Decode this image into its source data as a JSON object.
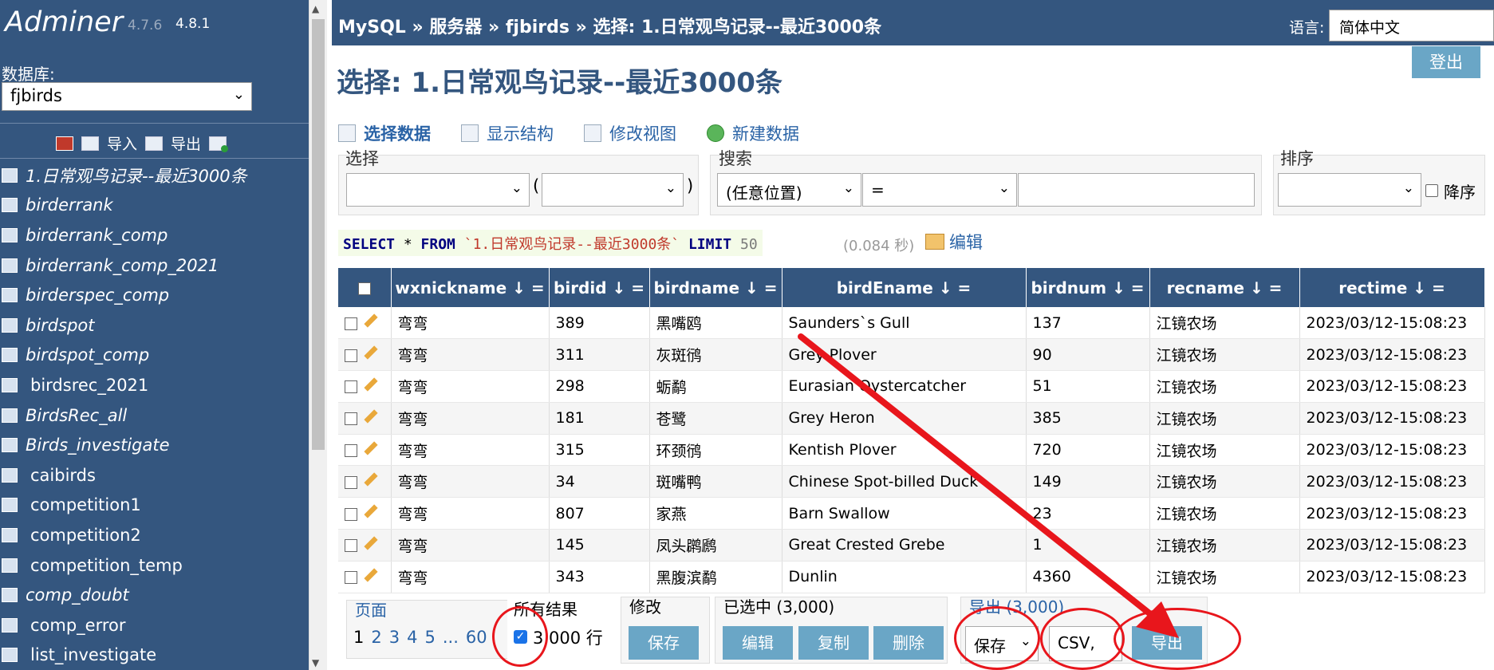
{
  "sidebar": {
    "logo": "Adminer",
    "version_old": "4.7.6",
    "version_new": "4.8.1",
    "db_label": "数据库:",
    "db_value": "fjbirds",
    "tools": {
      "import": "导入",
      "export": "导出"
    },
    "tables": [
      {
        "name": "1.日常观鸟记录--最近3000条",
        "italic": true
      },
      {
        "name": "birderrank",
        "italic": true
      },
      {
        "name": "birderrank_comp",
        "italic": true
      },
      {
        "name": "birderrank_comp_2021",
        "italic": true
      },
      {
        "name": "birderspec_comp",
        "italic": true
      },
      {
        "name": "birdspot",
        "italic": true
      },
      {
        "name": "birdspot_comp",
        "italic": true
      },
      {
        "name": "birdsrec_2021",
        "italic": false
      },
      {
        "name": "BirdsRec_all",
        "italic": true
      },
      {
        "name": "Birds_investigate",
        "italic": true
      },
      {
        "name": "caibirds",
        "italic": false
      },
      {
        "name": "competition1",
        "italic": false
      },
      {
        "name": "competition2",
        "italic": false
      },
      {
        "name": "competition_temp",
        "italic": false
      },
      {
        "name": "comp_doubt",
        "italic": true
      },
      {
        "name": "comp_error",
        "italic": false
      },
      {
        "name": "list_investigate",
        "italic": false
      }
    ]
  },
  "header": {
    "breadcrumb": "MySQL » 服务器 » fjbirds » 选择: 1.日常观鸟记录--最近3000条",
    "lang_label": "语言:",
    "lang_value": "简体中文",
    "logout": "登出"
  },
  "page_title": "选择: 1.日常观鸟记录--最近3000条",
  "actions": {
    "select_data": "选择数据",
    "show_structure": "显示结构",
    "alter_view": "修改视图",
    "new_item": "新建数据"
  },
  "filters": {
    "select_legend": "选择",
    "search_legend": "搜索",
    "search_anywhere": "(任意位置)",
    "search_op": "=",
    "sort_legend": "排序",
    "descending": "降序"
  },
  "sql": {
    "select_kw": "SELECT",
    "star": " * ",
    "from_kw": "FROM",
    "table": " `1.日常观鸟记录--最近3000条` ",
    "limit_kw": "LIMIT",
    "limit_val": " 50",
    "time": "(0.084 秒)",
    "edit": "编辑"
  },
  "table": {
    "columns": [
      "wxnickname ↓ =",
      "birdid ↓ =",
      "birdname ↓ =",
      "birdEname ↓ =",
      "birdnum ↓ =",
      "recname ↓ =",
      "rectime ↓ ="
    ],
    "rows": [
      [
        "弯弯",
        "389",
        "黑嘴鸥",
        "Saunders`s Gull",
        "137",
        "江镜农场",
        "2023/03/12-15:08:23"
      ],
      [
        "弯弯",
        "311",
        "灰斑鸻",
        "Grey Plover",
        "90",
        "江镜农场",
        "2023/03/12-15:08:23"
      ],
      [
        "弯弯",
        "298",
        "蛎鹬",
        "Eurasian Oystercatcher",
        "51",
        "江镜农场",
        "2023/03/12-15:08:23"
      ],
      [
        "弯弯",
        "181",
        "苍鹭",
        "Grey Heron",
        "385",
        "江镜农场",
        "2023/03/12-15:08:23"
      ],
      [
        "弯弯",
        "315",
        "环颈鸻",
        "Kentish Plover",
        "720",
        "江镜农场",
        "2023/03/12-15:08:23"
      ],
      [
        "弯弯",
        "34",
        "斑嘴鸭",
        "Chinese Spot-billed Duck",
        "149",
        "江镜农场",
        "2023/03/12-15:08:23"
      ],
      [
        "弯弯",
        "807",
        "家燕",
        "Barn Swallow",
        "23",
        "江镜农场",
        "2023/03/12-15:08:23"
      ],
      [
        "弯弯",
        "145",
        "凤头䴙䴘",
        "Great Crested Grebe",
        "1",
        "江镜农场",
        "2023/03/12-15:08:23"
      ],
      [
        "弯弯",
        "343",
        "黑腹滨鹬",
        "Dunlin",
        "4360",
        "江镜农场",
        "2023/03/12-15:08:23"
      ]
    ]
  },
  "footer": {
    "page_legend": "页面",
    "pages": [
      "1",
      "2",
      "3",
      "4",
      "5",
      "...",
      "60"
    ],
    "all_results_legend": "所有结果",
    "all_results_value": "3,000 行",
    "modify_legend": "修改",
    "save": "保存",
    "selected_legend": "已选中 (3,000)",
    "edit": "编辑",
    "clone": "复制",
    "delete": "删除",
    "export_legend": "导出 (3,000)",
    "export_output": "保存",
    "export_format": "CSV,",
    "export_button": "导出"
  },
  "colors": {
    "header_bg": "#34567f",
    "button_bg": "#6aa6c6",
    "link": "#2a63a6",
    "annotation_red": "#e8161c"
  }
}
